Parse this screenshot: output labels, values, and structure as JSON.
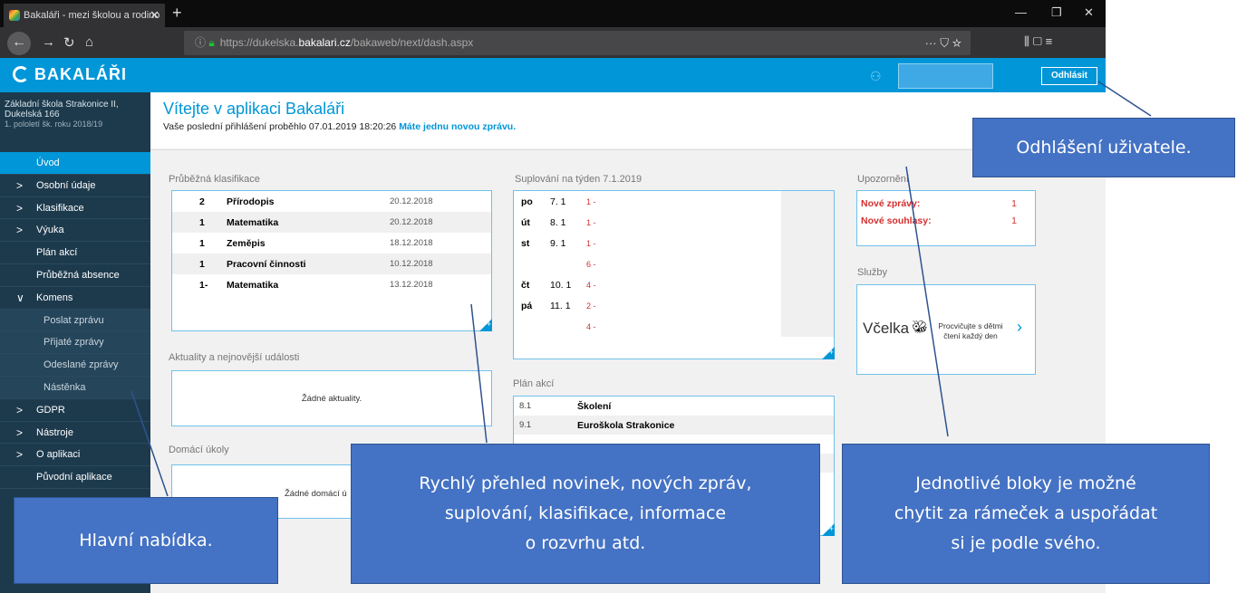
{
  "browser": {
    "tab_title": "Bakaláři - mezi školou a rodino",
    "tab_close": "✕",
    "new_tab": "+",
    "url_prefix": "https://dukelska.",
    "url_domain": "bakalari.cz",
    "url_path": "/bakaweb/next/dash.aspx",
    "url_actions": "··· ⛉ ☆",
    "toolbar_icons": "⫼ ▢ ≡"
  },
  "header": {
    "logo": "BAKALÁŘI",
    "logout": "Odhlásit"
  },
  "sidebar": {
    "school_line1": "Základní škola Strakonice II,",
    "school_line2": "Dukelská 166",
    "school_year": "1. pololetí šk. roku 2018/19",
    "items": [
      {
        "label": "Úvod"
      },
      {
        "label": "Osobní údaje"
      },
      {
        "label": "Klasifikace"
      },
      {
        "label": "Výuka"
      },
      {
        "label": "Plán akcí"
      },
      {
        "label": "Průběžná absence"
      },
      {
        "label": "Komens"
      },
      {
        "label": "Poslat zprávu"
      },
      {
        "label": "Přijaté zprávy"
      },
      {
        "label": "Odeslané zprávy"
      },
      {
        "label": "Nástěnka"
      },
      {
        "label": "GDPR"
      },
      {
        "label": "Nástroje"
      },
      {
        "label": "O aplikaci"
      },
      {
        "label": "Původní aplikace"
      }
    ]
  },
  "main": {
    "welcome": "Vítejte v aplikaci Bakaláři",
    "last_login": "Vaše poslední přihlášení proběhlo 07.01.2019 18:20:26",
    "new_message": "Máte jednu novou zprávu."
  },
  "grades": {
    "title": "Průběžná klasifikace",
    "rows": [
      {
        "grade": "2",
        "subject": "Přírodopis",
        "date": "20.12.2018"
      },
      {
        "grade": "1",
        "subject": "Matematika",
        "date": "20.12.2018"
      },
      {
        "grade": "1",
        "subject": "Zeměpis",
        "date": "18.12.2018"
      },
      {
        "grade": "1",
        "subject": "Pracovní činnosti",
        "date": "10.12.2018"
      },
      {
        "grade": "1-",
        "subject": "Matematika",
        "date": "13.12.2018"
      }
    ]
  },
  "news": {
    "title": "Aktuality a nejnovější události",
    "empty": "Žádné aktuality."
  },
  "homework": {
    "title": "Domácí úkoly",
    "empty": "Žádné domácí ú"
  },
  "substitutions": {
    "title": "Suplování na týden 7.1.2019",
    "rows": [
      {
        "day": "po",
        "date": "7. 1",
        "hour": "1 -"
      },
      {
        "day": "út",
        "date": "8. 1",
        "hour": "1 -"
      },
      {
        "day": "st",
        "date": "9. 1",
        "hour": "1 -"
      },
      {
        "day": "",
        "date": "",
        "hour": "6 -"
      },
      {
        "day": "čt",
        "date": "10. 1",
        "hour": "4 -"
      },
      {
        "day": "pá",
        "date": "11. 1",
        "hour": "2 -"
      },
      {
        "day": "",
        "date": "",
        "hour": "4 -"
      }
    ]
  },
  "plan": {
    "title": "Plán akcí",
    "rows": [
      {
        "date": "8.1",
        "name": "Školení"
      },
      {
        "date": "9.1",
        "name": "Euroškola Strakonice"
      }
    ]
  },
  "notices": {
    "title": "Upozornění",
    "rows": [
      {
        "label": "Nové zprávy:",
        "count": "1"
      },
      {
        "label": "Nové souhlasy:",
        "count": "1"
      }
    ]
  },
  "services": {
    "title": "Služby",
    "brand": "Včelka",
    "text1": "Procvičujte s dětmi",
    "text2": "čtení každý den"
  },
  "callouts": {
    "logout": "Odhlášení uživatele.",
    "menu": "Hlavní nabídka.",
    "overview_l1": "Rychlý přehled novinek, nových zpráv,",
    "overview_l2": "suplování, klasifikace, informace",
    "overview_l3": "o rozvrhu atd.",
    "blocks_l1": "Jednotlivé bloky je možné",
    "blocks_l2": "chytit za rámeček a uspořádat",
    "blocks_l3": "si je podle svého."
  },
  "colors": {
    "accent": "#0096d8",
    "sidebar": "#1d3a4d",
    "callout": "#4472c4",
    "alert": "#d32f2f"
  }
}
